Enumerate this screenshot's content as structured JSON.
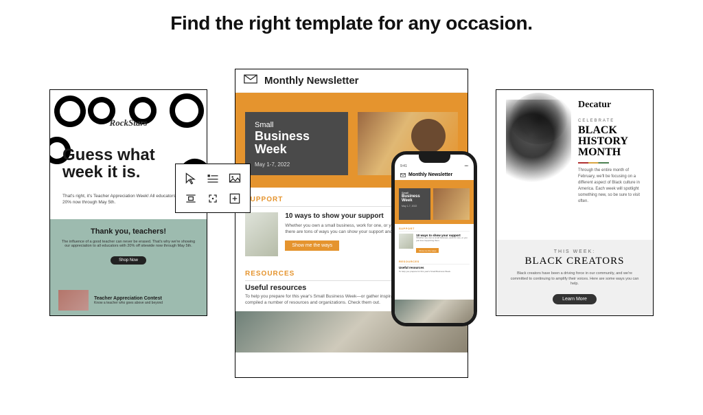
{
  "page": {
    "heading": "Find the right template for any occasion."
  },
  "left_template": {
    "logo": "RockStars",
    "headline_line1": "Guess what",
    "headline_line2": "week it is.",
    "subtext": "That's right, it's Teacher Appreciation Week! All educators save 20% now through May 5th.",
    "thanks_title": "Thank you, teachers!",
    "thanks_body": "The influence of a good teacher can never be erased. That's why we're showing our appreciation to all educators with 20% off sitewide now through May 5th.",
    "shop_button": "Shop Now",
    "contest_title": "Teacher Appreciation Contest",
    "contest_sub": "Know a teacher who goes above and beyond"
  },
  "center_template": {
    "title": "Monthly Newsletter",
    "hero_small": "Small",
    "hero_business": "Business",
    "hero_week": "Week",
    "hero_date": "May 1-7, 2022",
    "support_label": "SUPPORT",
    "support_heading": "10 ways to show your support",
    "support_body": "Whether you own a small business, work for one, or you just love supporting them, there are tons of ways you can show your support and take part in this annual tradition.",
    "support_cta": "Show me the ways",
    "resources_label": "RESOURCES",
    "useful_title": "Useful resources",
    "useful_body": "To help you prepare for this year's Small Business Week—or gather inspiration for next year—we've compiled a number of resources and organizations. Check them out."
  },
  "toolbox": {
    "icons": [
      "cursor-icon",
      "text-line-icon",
      "image-icon",
      "align-icon",
      "expand-icon",
      "plus-icon"
    ]
  },
  "phone": {
    "newsletter_title": "Monthly Newsletter",
    "hero_small": "Small",
    "hero_business": "Business",
    "hero_week": "Week",
    "hero_date": "May 1-7, 2022",
    "support_label": "SUPPORT",
    "support_heading": "10 ways to show your support",
    "support_body": "Whether you own a small business, work for one, or you just love supporting them.",
    "support_cta": "Show me the ways",
    "resources_label": "RESOURCES",
    "useful_title": "Useful resources",
    "useful_body": "To help you prepare for this year's Small Business Week."
  },
  "right_template": {
    "brand": "Decatur",
    "celebrate": "CELEBRATE",
    "bhm_line1": "BLACK",
    "bhm_line2": "HISTORY",
    "bhm_line3": "MONTH",
    "body": "Through the entire month of February, we'll be focusing on a different aspect of Black culture in America. Each week will spotlight something new, so be sure to visit often.",
    "this_week": "THIS WEEK:",
    "black_creators": "BLACK CREATORS",
    "lower_body": "Black creators have been a driving force in our community, and we're committed to continuing to amplify their voices. Here are some ways you can help.",
    "learn_button": "Learn More"
  }
}
